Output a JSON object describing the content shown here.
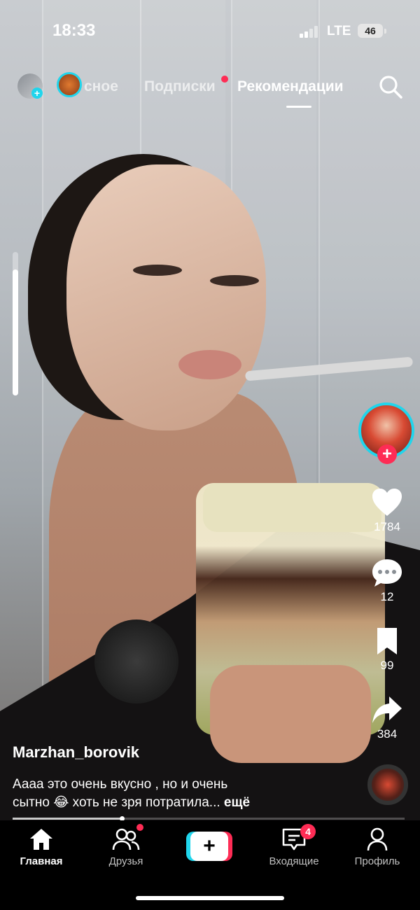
{
  "status_bar": {
    "time": "18:33",
    "network": "LTE",
    "battery": "46"
  },
  "top_nav": {
    "tabs": [
      {
        "label": "сное",
        "active": false
      },
      {
        "label": "Подписки",
        "active": false,
        "has_dot": true
      },
      {
        "label": "Рекомендации",
        "active": true
      }
    ],
    "icons": [
      "live-avatar",
      "story-avatar",
      "search-icon"
    ]
  },
  "actions": {
    "likes": "1784",
    "comments": "12",
    "saves": "99",
    "shares": "384"
  },
  "post": {
    "author": "Marzhan_borovik",
    "caption_line1": "Аааа это очень вкусно , но и очень",
    "caption_line2": "сытно 😂 хоть не зря потратила...",
    "more": "ещё"
  },
  "tab_bar": {
    "home": "Главная",
    "friends": "Друзья",
    "inbox": "Входящие",
    "inbox_badge": "4",
    "profile": "Профиль"
  },
  "colors": {
    "accent_red": "#fe2c55",
    "accent_cyan": "#20d5ec"
  }
}
